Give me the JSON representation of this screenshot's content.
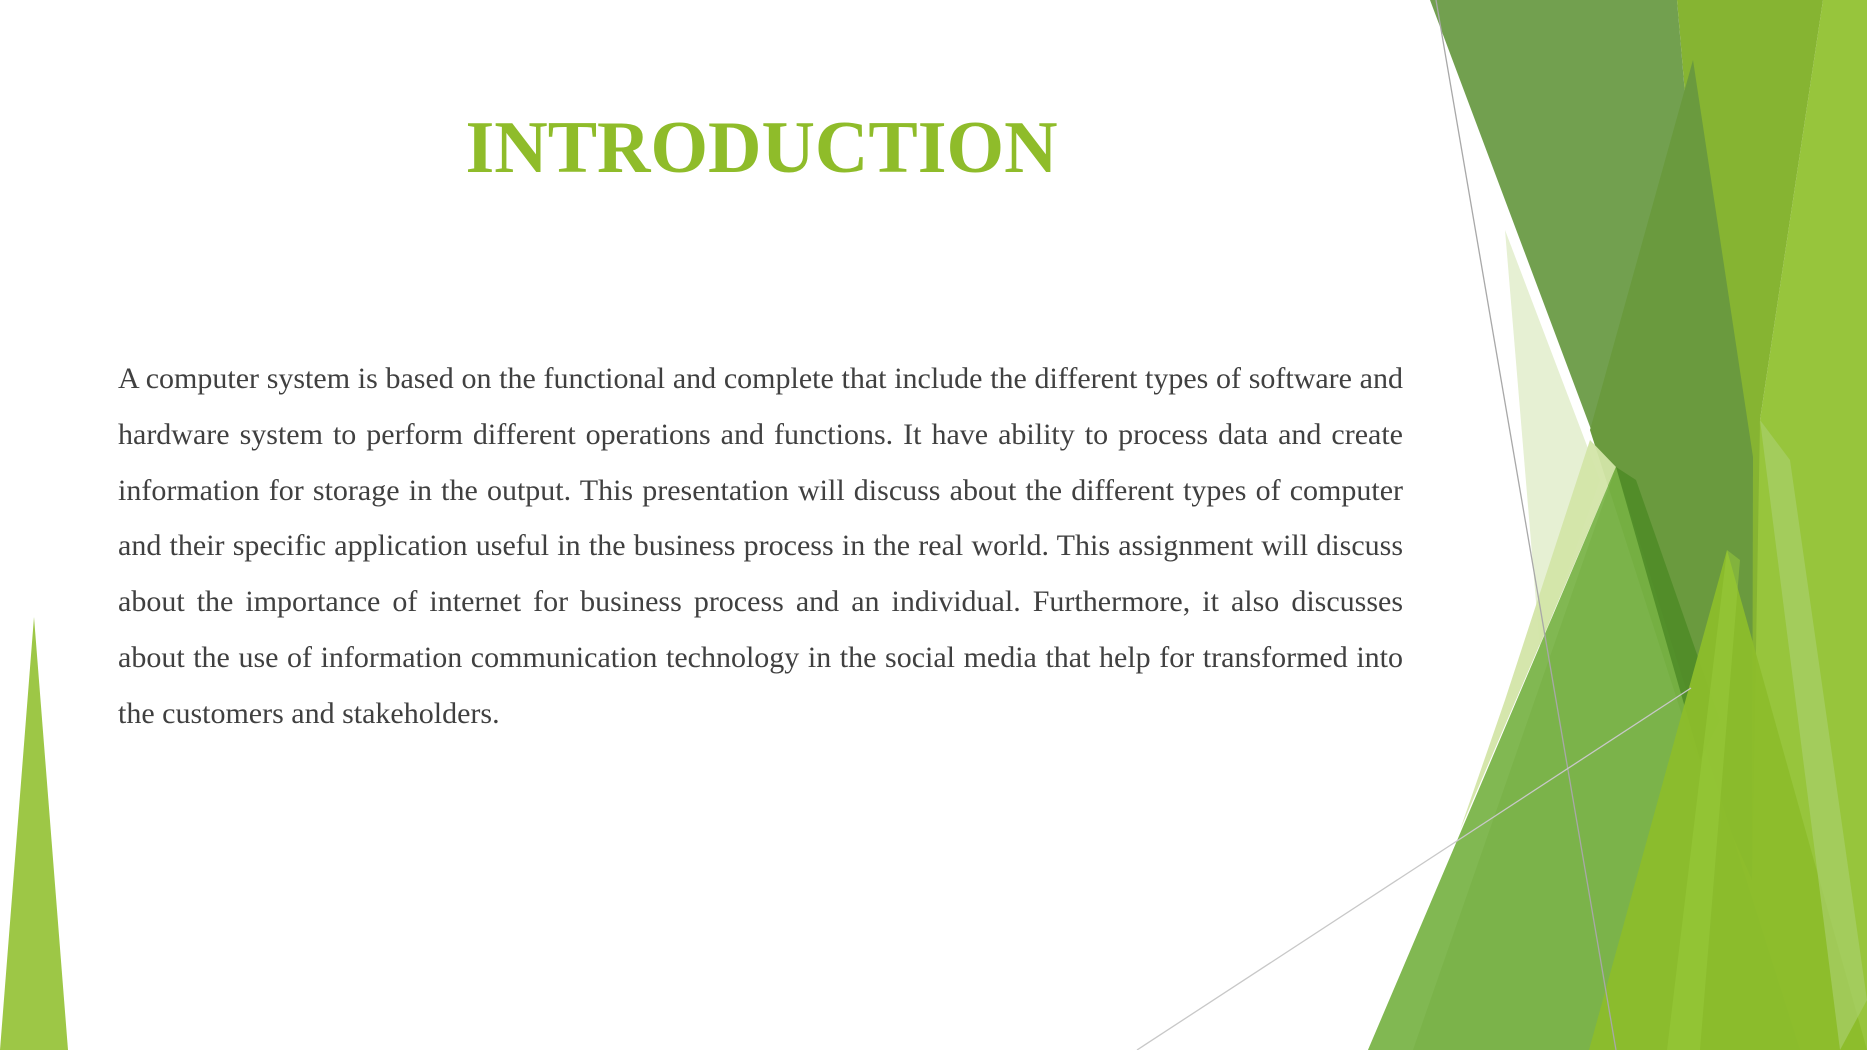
{
  "slide": {
    "title": "INTRODUCTION",
    "body": "A computer system is based on the functional and complete that include the different types of software and hardware system to perform different operations and functions. It have ability to process data and create information for storage in the output.  This presentation will discuss about the different types of computer and their specific application useful in the business process in the real world. This assignment will discuss about the importance of internet for business process and an individual. Furthermore, it also discusses about the use of information communication technology in the social media that help for transformed into the customers and stakeholders."
  },
  "theme": {
    "title_color": "#8fbc2a",
    "text_color": "#404040",
    "accent_colors": [
      "#72a04f",
      "#6a9a3e",
      "#86b432",
      "#97c53c",
      "#76b043",
      "#8cbd2b",
      "#9dc746",
      "#e6f0d3",
      "#d3e5a8",
      "#4e8b26"
    ]
  }
}
